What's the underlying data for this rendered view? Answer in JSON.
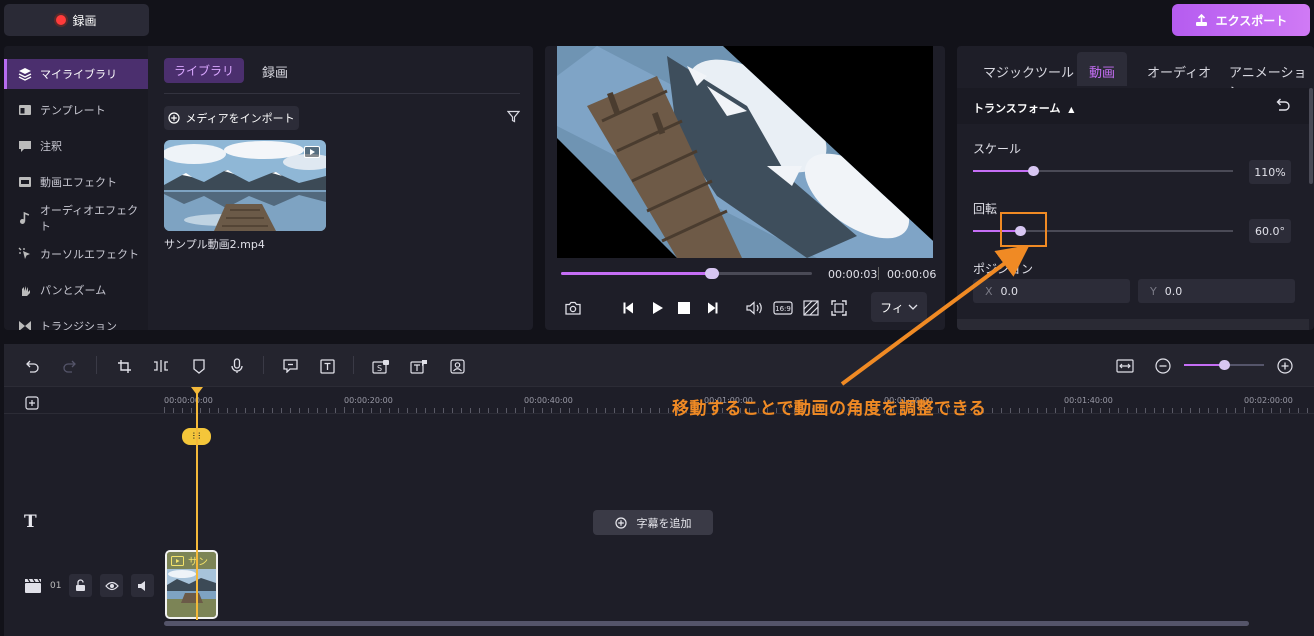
{
  "topbar": {
    "record_label": "録画",
    "export_label": "エクスポート"
  },
  "sidebar": {
    "items": [
      {
        "label": "マイライブラリ",
        "icon": "layers-icon"
      },
      {
        "label": "テンプレート",
        "icon": "template-icon"
      },
      {
        "label": "注釈",
        "icon": "comment-icon"
      },
      {
        "label": "動画エフェクト",
        "icon": "film-icon"
      },
      {
        "label": "オーディオエフェクト",
        "icon": "music-icon"
      },
      {
        "label": "カーソルエフェクト",
        "icon": "cursor-icon"
      },
      {
        "label": "パンとズーム",
        "icon": "pan-icon"
      },
      {
        "label": "トランジション",
        "icon": "transition-icon"
      }
    ]
  },
  "library": {
    "tabs": [
      "ライブラリ",
      "録画"
    ],
    "import_label": "メディアをインポート",
    "media": [
      {
        "name": "サンプル動画2.mp4"
      }
    ]
  },
  "preview": {
    "time_current": "00:00:03",
    "time_total": "00:00:06",
    "progress": 0.6,
    "fit_label": "フィ"
  },
  "inspector": {
    "tabs": [
      "マジックツール",
      "動画",
      "オーディオ",
      "アニメーション"
    ],
    "active_tab": "動画",
    "section_title": "トランスフォーム",
    "scale": {
      "label": "スケール",
      "value": "110%",
      "level": 0.23
    },
    "rotation": {
      "label": "回転",
      "value": "60.0°",
      "level": 0.18
    },
    "position": {
      "label": "ポジション",
      "x_label": "X",
      "x": "0.0",
      "y_label": "Y",
      "y": "0.0"
    }
  },
  "timeline": {
    "ruler_labels": [
      "00:00:00:00",
      "00:00:20:00",
      "00:00:40:00",
      "00:01:00:00",
      "00:01:20:00",
      "00:01:40:00",
      "00:02:00:00"
    ],
    "split_chip": "⫶|⫶",
    "add_caption_label": "字幕を追加",
    "track_number": "01",
    "clip_label": "サン",
    "zoom_level": 0.5
  },
  "annotation": {
    "text": "移動することで動画の角度を調整できる",
    "color": "#f08a24"
  },
  "colors": {
    "accent": "#c56ef5",
    "playhead": "#f4b93a",
    "background": "#121219"
  }
}
